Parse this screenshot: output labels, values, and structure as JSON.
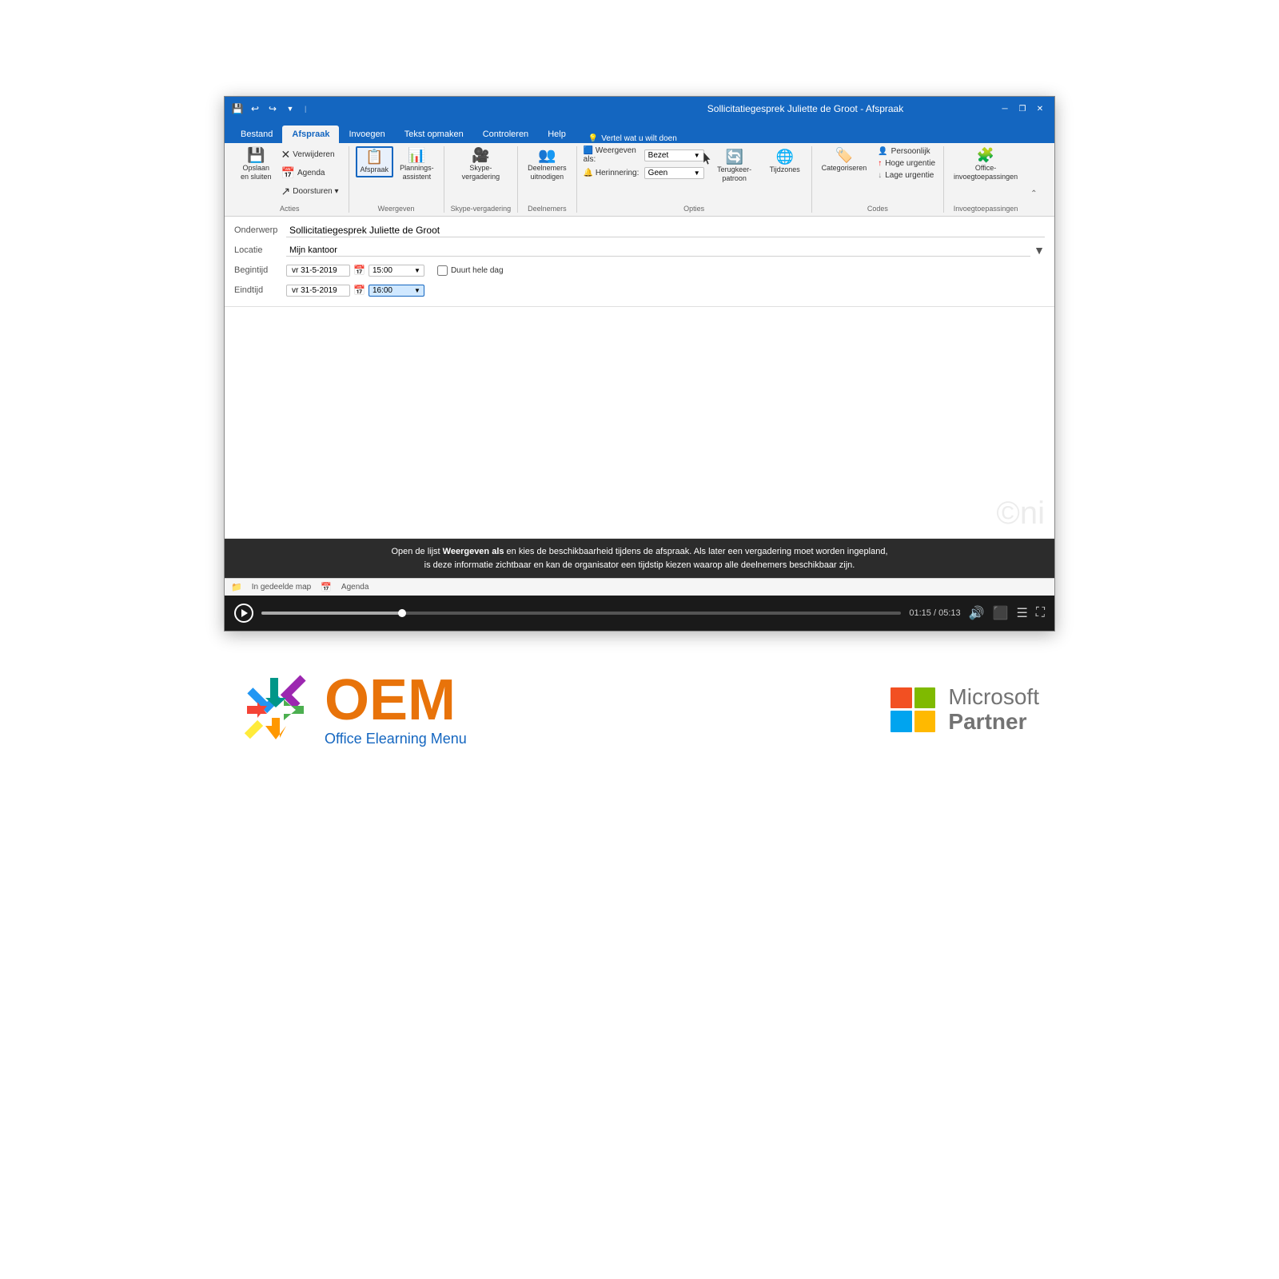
{
  "window": {
    "title": "Sollicitatiegesprek Juliette de Groot - Afspraak",
    "tabs": [
      "Bestand",
      "Afspraak",
      "Invoegen",
      "Tekst opmaken",
      "Controleren",
      "Help"
    ],
    "active_tab": "Afspraak",
    "tell_me": "Vertel wat u wilt doen"
  },
  "quick_access": {
    "icons": [
      "save",
      "undo",
      "redo",
      "settings"
    ]
  },
  "ribbon": {
    "groups": {
      "acties": {
        "label": "Acties",
        "buttons": [
          {
            "id": "opslaan",
            "label": "Opslaan\nen sluiten",
            "icon": "💾"
          },
          {
            "id": "verwijderen",
            "label": "Verwijderen",
            "icon": "✕"
          },
          {
            "id": "agenda",
            "label": "Agenda",
            "icon": "📅"
          },
          {
            "id": "doorsturen",
            "label": "Doorsturen",
            "icon": "→"
          }
        ]
      },
      "weergeven": {
        "label": "Weergeven",
        "buttons": [
          {
            "id": "afspraak",
            "label": "Afspraak",
            "icon": "📋"
          },
          {
            "id": "planningsassistent",
            "label": "Plannings-\nassistent",
            "icon": "📊"
          }
        ]
      },
      "skype": {
        "label": "Skype-vergadering",
        "buttons": [
          {
            "id": "skype",
            "label": "Skype-\nvergadering",
            "icon": "🎥"
          }
        ]
      },
      "deelnemers": {
        "label": "Deelnemers",
        "buttons": [
          {
            "id": "deelnemers",
            "label": "Deelnemers\nuitnodigen",
            "icon": "👥"
          }
        ]
      },
      "opties": {
        "label": "Opties",
        "weergeven_als_label": "Weergeven als:",
        "weergeven_als_value": "Bezet",
        "herinnering_label": "Herinnering:",
        "herinnering_value": "Geen",
        "terugkeerpatroon": "Terugkeerpatroon",
        "tijdzones": "Tijdzones"
      },
      "codes": {
        "label": "Codes",
        "categoriseren": "Categoriseren",
        "persoonlijk": "Persoonlijk",
        "hoge_urgentie": "Hoge urgentie",
        "lage_urgentie": "Lage urgentie"
      },
      "invoegtoepassingen": {
        "label": "Invoegtoepassingen",
        "button_label": "Office-\ninvoegtoepassingen"
      }
    }
  },
  "form": {
    "onderwerp_label": "Onderwerp",
    "onderwerp_value": "Sollicitatiegesprek Juliette de Groot",
    "locatie_label": "Locatie",
    "locatie_value": "Mijn kantoor",
    "begintijd_label": "Begintijd",
    "begintijd_date": "vr 31-5-2019",
    "begintijd_time": "15:00",
    "eindtijd_label": "Eindtijd",
    "eindtijd_date": "vr 31-5-2019",
    "eindtijd_time": "16:00",
    "duurt_hele_dag": "Duurt hele dag"
  },
  "status_bar": {
    "in_gedeelde_map": "In gedeelde map",
    "agenda": "Agenda"
  },
  "subtitle": {
    "line1_pre": "Open de lijst ",
    "line1_bold": "Weergeven als",
    "line1_post": " en kies de beschikbaarheid tijdens de afspraak. Als later een vergadering moet worden ingepland,",
    "line2": "is deze informatie zichtbaar en kan de organisator een tijdstip kiezen waarop alle deelnemers beschikbaar zijn."
  },
  "video_controls": {
    "current_time": "01:15",
    "total_time": "05:13",
    "progress_percent": 22
  },
  "logos": {
    "oem_name": "OEM",
    "oem_sub": "Office Elearning Menu",
    "ms_microsoft": "Microsoft",
    "ms_partner": "Partner"
  },
  "ms_colors": {
    "red": "#F25022",
    "green": "#7FBA00",
    "blue": "#00A4EF",
    "yellow": "#FFB900"
  }
}
